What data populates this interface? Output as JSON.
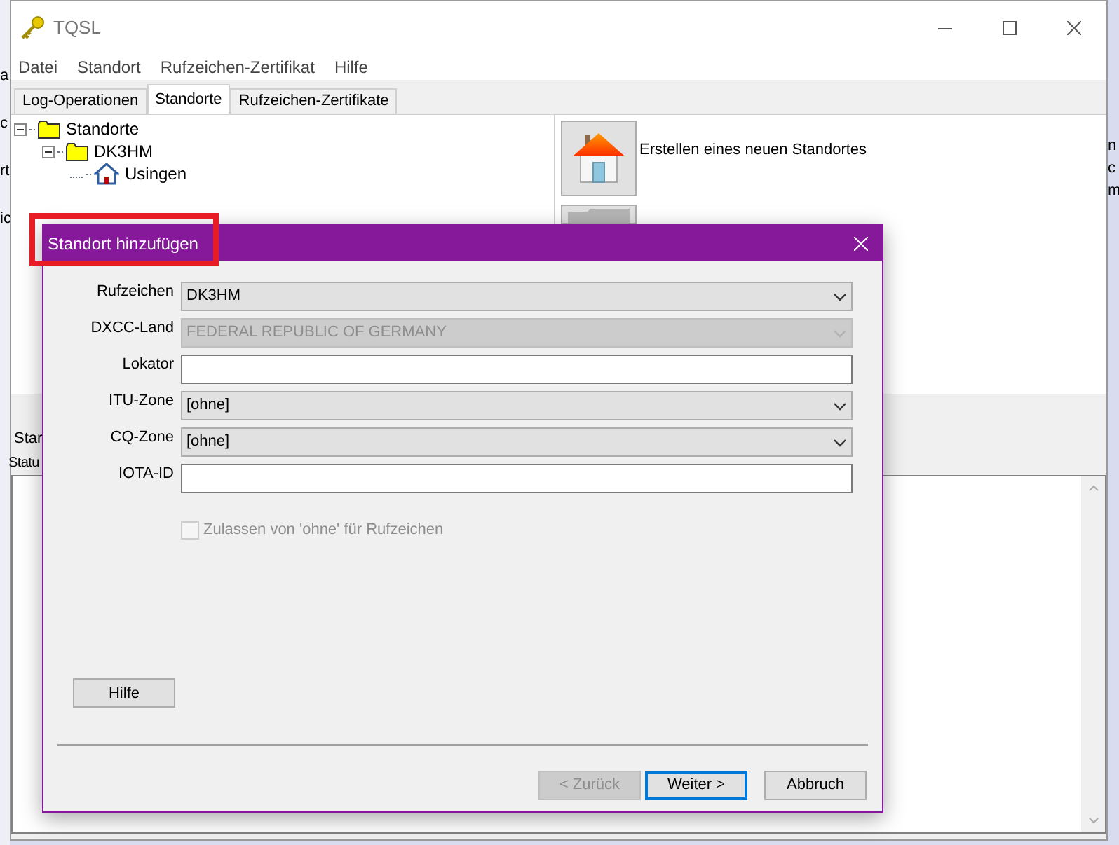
{
  "window": {
    "title": "TQSL"
  },
  "menu": [
    "Datei",
    "Standort",
    "Rufzeichen-Zertifikat",
    "Hilfe"
  ],
  "tabs": [
    {
      "label": "Log-Operationen",
      "selected": false
    },
    {
      "label": "Standorte",
      "selected": true
    },
    {
      "label": "Rufzeichen-Zertifikate",
      "selected": false
    }
  ],
  "tree": [
    {
      "label": "Standorte",
      "kind": "folder",
      "expanded": true,
      "children": [
        {
          "label": "DK3HM",
          "kind": "folder",
          "expanded": true,
          "children": [
            {
              "label": "Usingen",
              "kind": "location"
            }
          ]
        }
      ]
    }
  ],
  "actions": [
    {
      "kind": "house",
      "label": "Erstellen eines neuen Standortes"
    },
    {
      "kind": "folder"
    }
  ],
  "lower_panel": {
    "tab_label": "Star",
    "status_label": "Statu"
  },
  "background_window": {
    "left_texts": [
      "a",
      "c",
      "rt",
      "ic"
    ],
    "right_texts": [
      "n",
      "c",
      "m"
    ]
  },
  "dialog": {
    "title": "Standort hinzufügen",
    "highlighted": true,
    "fields": [
      {
        "label": "Rufzeichen",
        "kind": "dropdown",
        "value": "DK3HM",
        "disabled": false
      },
      {
        "label": "DXCC-Land",
        "kind": "dropdown",
        "value": "FEDERAL REPUBLIC OF GERMANY",
        "disabled": true
      },
      {
        "label": "Lokator",
        "kind": "text"
      },
      {
        "label": "ITU-Zone",
        "kind": "dropdown",
        "value": "[ohne]",
        "disabled": false
      },
      {
        "label": "CQ-Zone",
        "kind": "dropdown",
        "value": "[ohne]",
        "disabled": false
      },
      {
        "label": "IOTA-ID",
        "kind": "text"
      }
    ],
    "checkbox": {
      "label": "Zulassen von 'ohne' für Rufzeichen",
      "checked": false,
      "disabled": true
    },
    "help_button": "Hilfe",
    "buttons": [
      {
        "label": "< Zurück",
        "disabled": true,
        "default": false
      },
      {
        "label": "Weiter >",
        "disabled": false,
        "default": true
      },
      {
        "label": "Abbruch",
        "disabled": false,
        "default": false
      }
    ]
  }
}
